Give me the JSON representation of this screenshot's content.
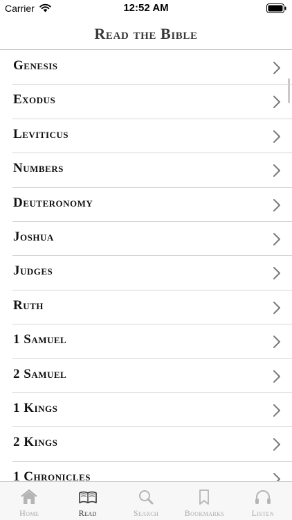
{
  "status_bar": {
    "carrier": "Carrier",
    "time": "12:52 AM"
  },
  "header": {
    "title": "Read the Bible"
  },
  "books": [
    {
      "name": "Genesis"
    },
    {
      "name": "Exodus"
    },
    {
      "name": "Leviticus"
    },
    {
      "name": "Numbers"
    },
    {
      "name": "Deuteronomy"
    },
    {
      "name": "Joshua"
    },
    {
      "name": "Judges"
    },
    {
      "name": "Ruth"
    },
    {
      "name": "1 Samuel"
    },
    {
      "name": "2 Samuel"
    },
    {
      "name": "1 Kings"
    },
    {
      "name": "2 Kings"
    },
    {
      "name": "1 Chronicles"
    }
  ],
  "tabs": [
    {
      "label": "Home",
      "icon": "home-icon",
      "active": false
    },
    {
      "label": "Read",
      "icon": "book-icon",
      "active": true
    },
    {
      "label": "Search",
      "icon": "search-icon",
      "active": false
    },
    {
      "label": "Bookmarks",
      "icon": "bookmark-icon",
      "active": false
    },
    {
      "label": "Listen",
      "icon": "headphones-icon",
      "active": false
    }
  ],
  "colors": {
    "active_tab": "#333333",
    "inactive_tab": "#a9a9a9",
    "chevron": "#7a7a7a"
  }
}
